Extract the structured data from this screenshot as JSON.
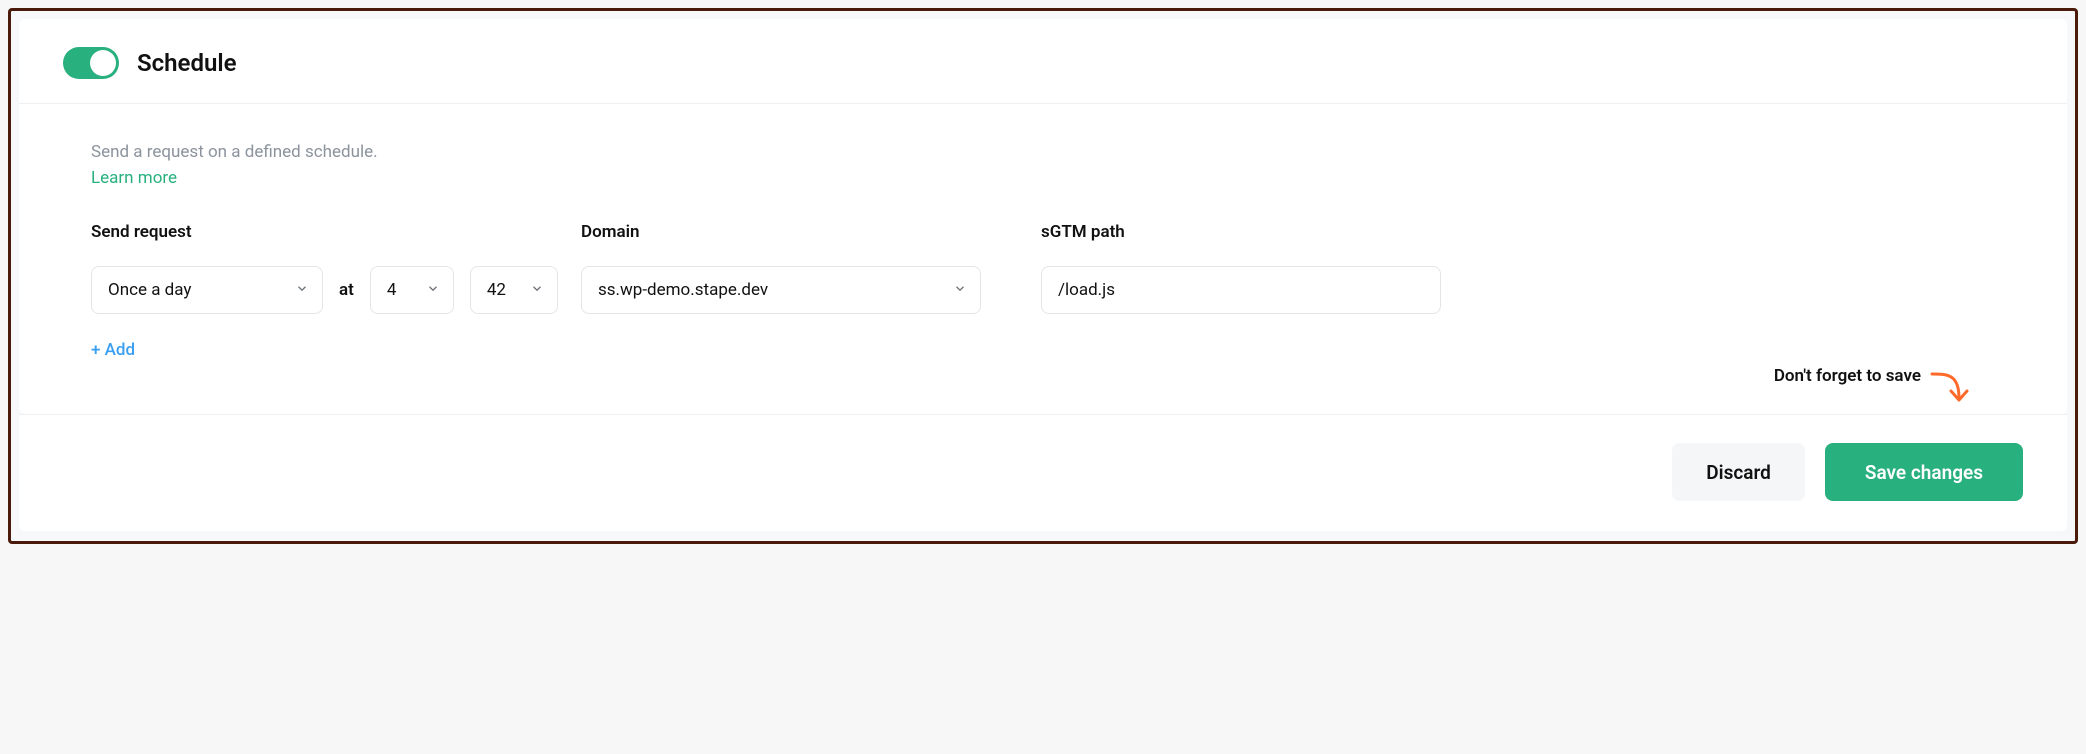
{
  "schedule": {
    "enabled": true,
    "title": "Schedule",
    "description": "Send a request on a defined schedule.",
    "learn_more": "Learn more"
  },
  "labels": {
    "send_request": "Send request",
    "at": "at",
    "domain": "Domain",
    "sgtm_path": "sGTM path",
    "add": "+ Add"
  },
  "values": {
    "frequency": "Once a day",
    "hour": "4",
    "minute": "42",
    "domain": "ss.wp-demo.stape.dev",
    "path": "/load.js"
  },
  "hint": "Don't forget to save",
  "buttons": {
    "discard": "Discard",
    "save": "Save changes"
  },
  "colors": {
    "accent": "#29b07f",
    "link_blue": "#3a9ff0",
    "arrow": "#ff6a2a"
  }
}
